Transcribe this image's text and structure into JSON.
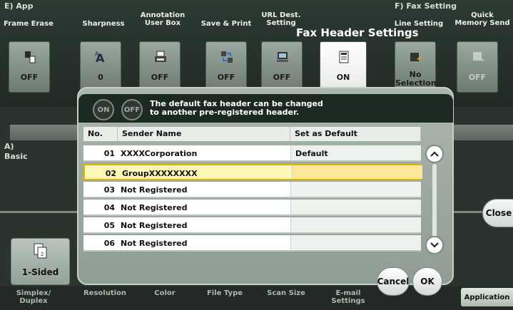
{
  "window": {
    "title": "Fax Header Settings"
  },
  "sections": {
    "left": "E)  App",
    "right": "F)  Fax Setting",
    "basic": "A)\nBasic"
  },
  "functions": [
    {
      "label": "Frame Erase",
      "value": "OFF",
      "icon": "frame-erase-icon"
    },
    {
      "label": "Sharpness",
      "value": "0",
      "icon": "sharpness-icon"
    },
    {
      "label": "Annotation\nUser Box",
      "value": "OFF",
      "icon": "annotation-icon"
    },
    {
      "label": "Save & Print",
      "value": "OFF",
      "icon": "save-print-icon"
    },
    {
      "label": "URL Dest.\nSetting",
      "value": "OFF",
      "icon": "url-icon"
    },
    {
      "label": "",
      "value": "ON",
      "icon": "fax-header-icon"
    },
    {
      "label": "Line Setting",
      "value": "No\nSelection",
      "icon": "line-setting-icon"
    },
    {
      "label": "Quick\nMemory Send",
      "value": "OFF",
      "icon": "quick-memory-icon"
    }
  ],
  "dialog": {
    "toggle_on": "ON",
    "toggle_off": "OFF",
    "message": "The default fax header can be changed\nto another pre-registered header.",
    "columns": [
      "No.",
      "Sender Name",
      "Set as Default"
    ],
    "rows": [
      {
        "no": "01",
        "name": "XXXXCorporation",
        "default": "Default"
      },
      {
        "no": "02",
        "name": "GroupXXXXXXXX",
        "default": ""
      },
      {
        "no": "03",
        "name": "Not Registered",
        "default": ""
      },
      {
        "no": "04",
        "name": "Not Registered",
        "default": ""
      },
      {
        "no": "05",
        "name": "Not Registered",
        "default": ""
      },
      {
        "no": "06",
        "name": "Not Registered",
        "default": ""
      }
    ],
    "cancel": "Cancel",
    "ok": "OK"
  },
  "side": {
    "close": "Close",
    "one_sided": "1-Sided"
  },
  "bottom": {
    "items": [
      "Simplex/\nDuplex",
      "Resolution",
      "Color",
      "File Type",
      "Scan Size",
      "E-mail\nSettings"
    ],
    "application": "Application"
  }
}
